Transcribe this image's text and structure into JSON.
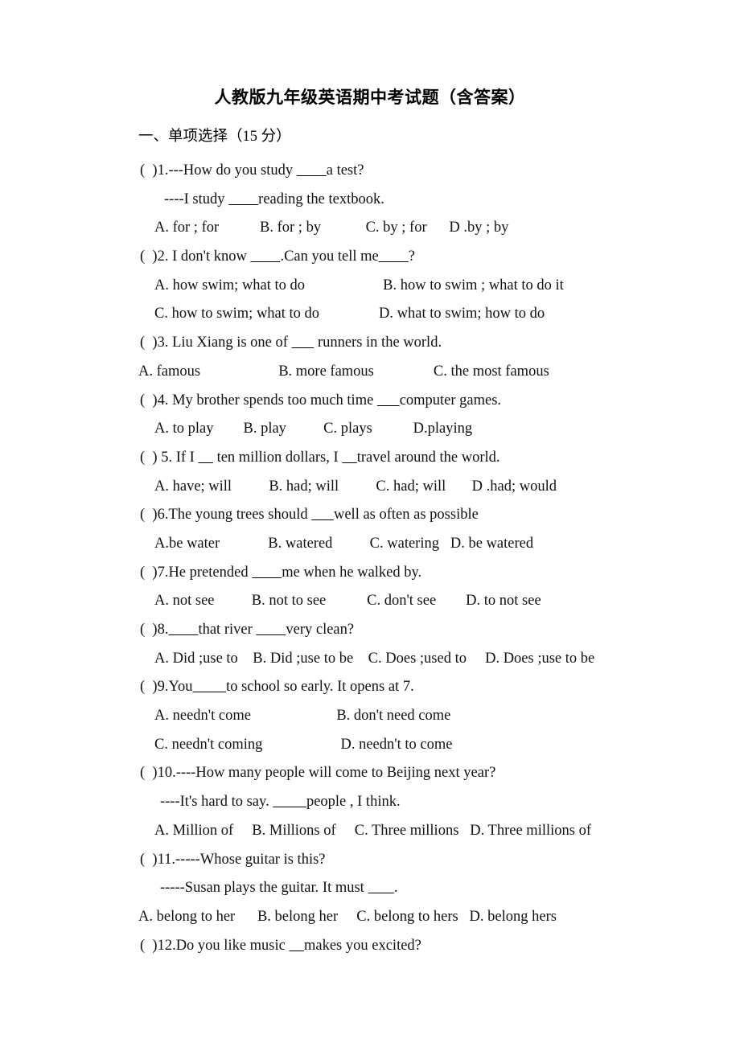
{
  "document": {
    "title": "人教版九年级英语期中考试题（含答案）",
    "section_heading": "一、单项选择（15 分）"
  },
  "questions": [
    {
      "number": "1",
      "stem": "（  ）1.---How do you study ________a test?",
      "reply": "----I study ________reading the textbook.",
      "options_layout": "indented",
      "option_lines": [
        "A. for ; for          B. for ; by          C. by ; for      D .by ; by"
      ]
    },
    {
      "number": "2",
      "stem": "（  ）2. I don't know ________.Can you tell me________?",
      "options_layout": "indented",
      "option_lines": [
        "A. how swim; what to do                    B. how to swim ; what to do it",
        "C. how to swim; what to do                 D. what to swim; how to do"
      ]
    },
    {
      "number": "3",
      "stem": "（  ）3. Liu Xiang is one of ______ runners in the world.",
      "options_layout": "flush",
      "option_lines": [
        "A. famous                    B. more famous                 C. the most famous"
      ]
    },
    {
      "number": "4",
      "stem": "（  ）4. My brother spends too much time ______computer games.",
      "options_layout": "indented",
      "option_lines": [
        "A. to play        B. play         C. plays          D.playing"
      ]
    },
    {
      "number": "5",
      "stem": "（  ) 5. If I ____ ten million dollars, I ____travel around the world.",
      "options_layout": "indented",
      "option_lines": [
        "A. have; will          B. had; will          C. had; will       D .had; would"
      ]
    },
    {
      "number": "6",
      "stem": "（  ）6.The young trees should ______well as often as possible",
      "options_layout": "indented",
      "option_lines": [
        "A.be water             B. watered          C. watering   D. be watered"
      ]
    },
    {
      "number": "7",
      "stem": "（  ）7.He pretended ________me when he walked by.",
      "options_layout": "indented",
      "option_lines": [
        "A. not see          B. not to see           C. don't see        D. to not see"
      ]
    },
    {
      "number": "8",
      "stem": "（  ）8.________that river ________very clean?",
      "options_layout": "indented",
      "option_lines": [
        "A. Did ;use to    B. Did ;use to be    C. Does ;used to     D. Does ;use to be"
      ]
    },
    {
      "number": "9",
      "stem": "（  ）9.You_________to school so early. It opens at 7.",
      "options_layout": "indented",
      "option_lines": [
        "A. needn't come                      B. don't need come",
        "C. needn't coming                    D. needn't to come"
      ]
    },
    {
      "number": "10",
      "stem": "（  ）10.----How many people will come to Beijing next year?",
      "reply": "----It's hard to say. _________people , I think.",
      "options_layout": "indented",
      "option_lines": [
        "A. Million of     B. Millions of     C. Three millions   D. Three millions of"
      ]
    },
    {
      "number": "11",
      "stem": "（  ）11.-----Whose guitar is this?",
      "reply": "-----Susan plays the guitar. It must _______.",
      "options_layout": "flush",
      "option_lines": [
        "A. belong to her      B. belong her     C. belong to hers   D. belong hers"
      ]
    },
    {
      "number": "12",
      "stem": "（  ）12.Do you like music ____makes you excited?",
      "options_layout": "indented",
      "option_lines": []
    }
  ],
  "lines": [
    {
      "indent": "stem",
      "text": "(  )1.---How do you study ________a test?"
    },
    {
      "indent": "reply",
      "text": "----I study ________reading the textbook."
    },
    {
      "indent": "opt",
      "text": "A. for ; for           B. for ; by            C. by ; for      D .by ; by"
    },
    {
      "indent": "stem",
      "text": "(  )2. I don't know ________.Can you tell me________?"
    },
    {
      "indent": "opt",
      "text": "A. how swim; what to do                     B. how to swim ; what to do it"
    },
    {
      "indent": "opt",
      "text": "C. how to swim; what to do                D. what to swim; how to do"
    },
    {
      "indent": "stem",
      "text": "(  )3. Liu Xiang is one of ______ runners in the world."
    },
    {
      "indent": "flush",
      "text": "A. famous                     B. more famous                C. the most famous"
    },
    {
      "indent": "stem",
      "text": "(  )4. My brother spends too much time ______computer games."
    },
    {
      "indent": "opt",
      "text": "A. to play        B. play          C. plays           D.playing"
    },
    {
      "indent": "stem",
      "text": "(  ) 5. If I ____ ten million dollars, I ____travel around the world."
    },
    {
      "indent": "opt",
      "text": "A. have; will          B. had; will          C. had; will       D .had; would"
    },
    {
      "indent": "stem",
      "text": "(  )6.The young trees should ______well as often as possible"
    },
    {
      "indent": "opt",
      "text": "A.be water             B. watered          C. watering   D. be watered"
    },
    {
      "indent": "stem",
      "text": "(  )7.He pretended ________me when he walked by."
    },
    {
      "indent": "opt",
      "text": "A. not see          B. not to see           C. don't see        D. to not see"
    },
    {
      "indent": "stem",
      "text": "(  )8.________that river ________very clean?"
    },
    {
      "indent": "opt",
      "text": "A. Did ;use to    B. Did ;use to be    C. Does ;used to     D. Does ;use to be"
    },
    {
      "indent": "stem",
      "text": "(  )9.You_________to school so early. It opens at 7."
    },
    {
      "indent": "opt",
      "text": "A. needn't come                       B. don't need come"
    },
    {
      "indent": "opt",
      "text": "C. needn't coming                     D. needn't to come"
    },
    {
      "indent": "stem",
      "text": "(  )10.----How many people will come to Beijing next year?"
    },
    {
      "indent": "reply2",
      "text": "----It's hard to say. _________people , I think."
    },
    {
      "indent": "opt",
      "text": "A. Million of     B. Millions of     C. Three millions   D. Three millions of"
    },
    {
      "indent": "stem",
      "text": "(  )11.-----Whose guitar is this?"
    },
    {
      "indent": "reply2",
      "text": "-----Susan plays the guitar. It must _______."
    },
    {
      "indent": "flush",
      "text": "A. belong to her      B. belong her     C. belong to hers   D. belong hers"
    },
    {
      "indent": "stem",
      "text": "(  )12.Do you like music ____makes you excited?"
    }
  ]
}
